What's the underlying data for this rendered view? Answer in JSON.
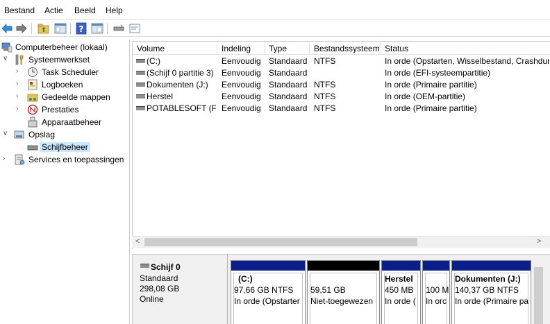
{
  "menu": [
    "Bestand",
    "Actie",
    "Beeld",
    "Help"
  ],
  "toolbar": {
    "buttons": [
      "back-icon",
      "forward-icon",
      "up-folder-icon",
      "show-hide-tree-icon",
      "help-icon",
      "properties-icon",
      "connect-icon",
      "rescan-icon"
    ]
  },
  "tree": {
    "root": "Computerbeheer (lokaal)",
    "systeem": "Systeemwerkset",
    "task": "Task Scheduler",
    "log": "Logboeken",
    "gedeeld": "Gedeelde mappen",
    "prestaties": "Prestaties",
    "apparaat": "Apparaatbeheer",
    "opslag": "Opslag",
    "schijf": "Schijfbeheer",
    "services": "Services en toepassingen"
  },
  "columns": [
    "Volume",
    "Indeling",
    "Type",
    "Bestandssysteem",
    "Status"
  ],
  "volumes": [
    {
      "volume": " (C:)",
      "indeling": "Eenvoudig",
      "type": "Standaard",
      "fs": "NTFS",
      "status": "In orde (Opstarten, Wisselbestand, Crashdur"
    },
    {
      "volume": "(Schijf 0 partitie 3)",
      "indeling": "Eenvoudig",
      "type": "Standaard",
      "fs": "",
      "status": "In orde (EFI-systeempartitie)"
    },
    {
      "volume": "Dokumenten (J:)",
      "indeling": "Eenvoudig",
      "type": "Standaard",
      "fs": "NTFS",
      "status": "In orde (Primaire partitie)"
    },
    {
      "volume": "Herstel",
      "indeling": "Eenvoudig",
      "type": "Standaard",
      "fs": "NTFS",
      "status": "In orde (OEM-partitie)"
    },
    {
      "volume": "POTABLESOFT (F:)",
      "indeling": "Eenvoudig",
      "type": "Standaard",
      "fs": "NTFS",
      "status": "In orde (Primaire partitie)"
    }
  ],
  "scroll": {
    "left": "<",
    "right": ">"
  },
  "disk": {
    "name": "Schijf 0",
    "type": "Standaard",
    "size": "298,08 GB",
    "state": "Online"
  },
  "partitions": [
    {
      "name": "(C:)",
      "size": "97,66 GB NTFS",
      "status": "In orde (Opstarter",
      "bar_color": "#0a1e8c"
    },
    {
      "name": "",
      "size": "59,51 GB",
      "status": "Niet-toegewezen",
      "bar_color": "#000000"
    },
    {
      "name": "Herstel",
      "size": "450 MB",
      "status": "In orde (",
      "bar_color": "#0a1e8c"
    },
    {
      "name": "",
      "size": "100 M",
      "status": "In orc",
      "bar_color": "#0a1e8c"
    },
    {
      "name": "Dokumenten (J:)",
      "size": "140,37 GB NTFS",
      "status": "In orde (Primaire pa",
      "bar_color": "#0a1e8c"
    }
  ]
}
